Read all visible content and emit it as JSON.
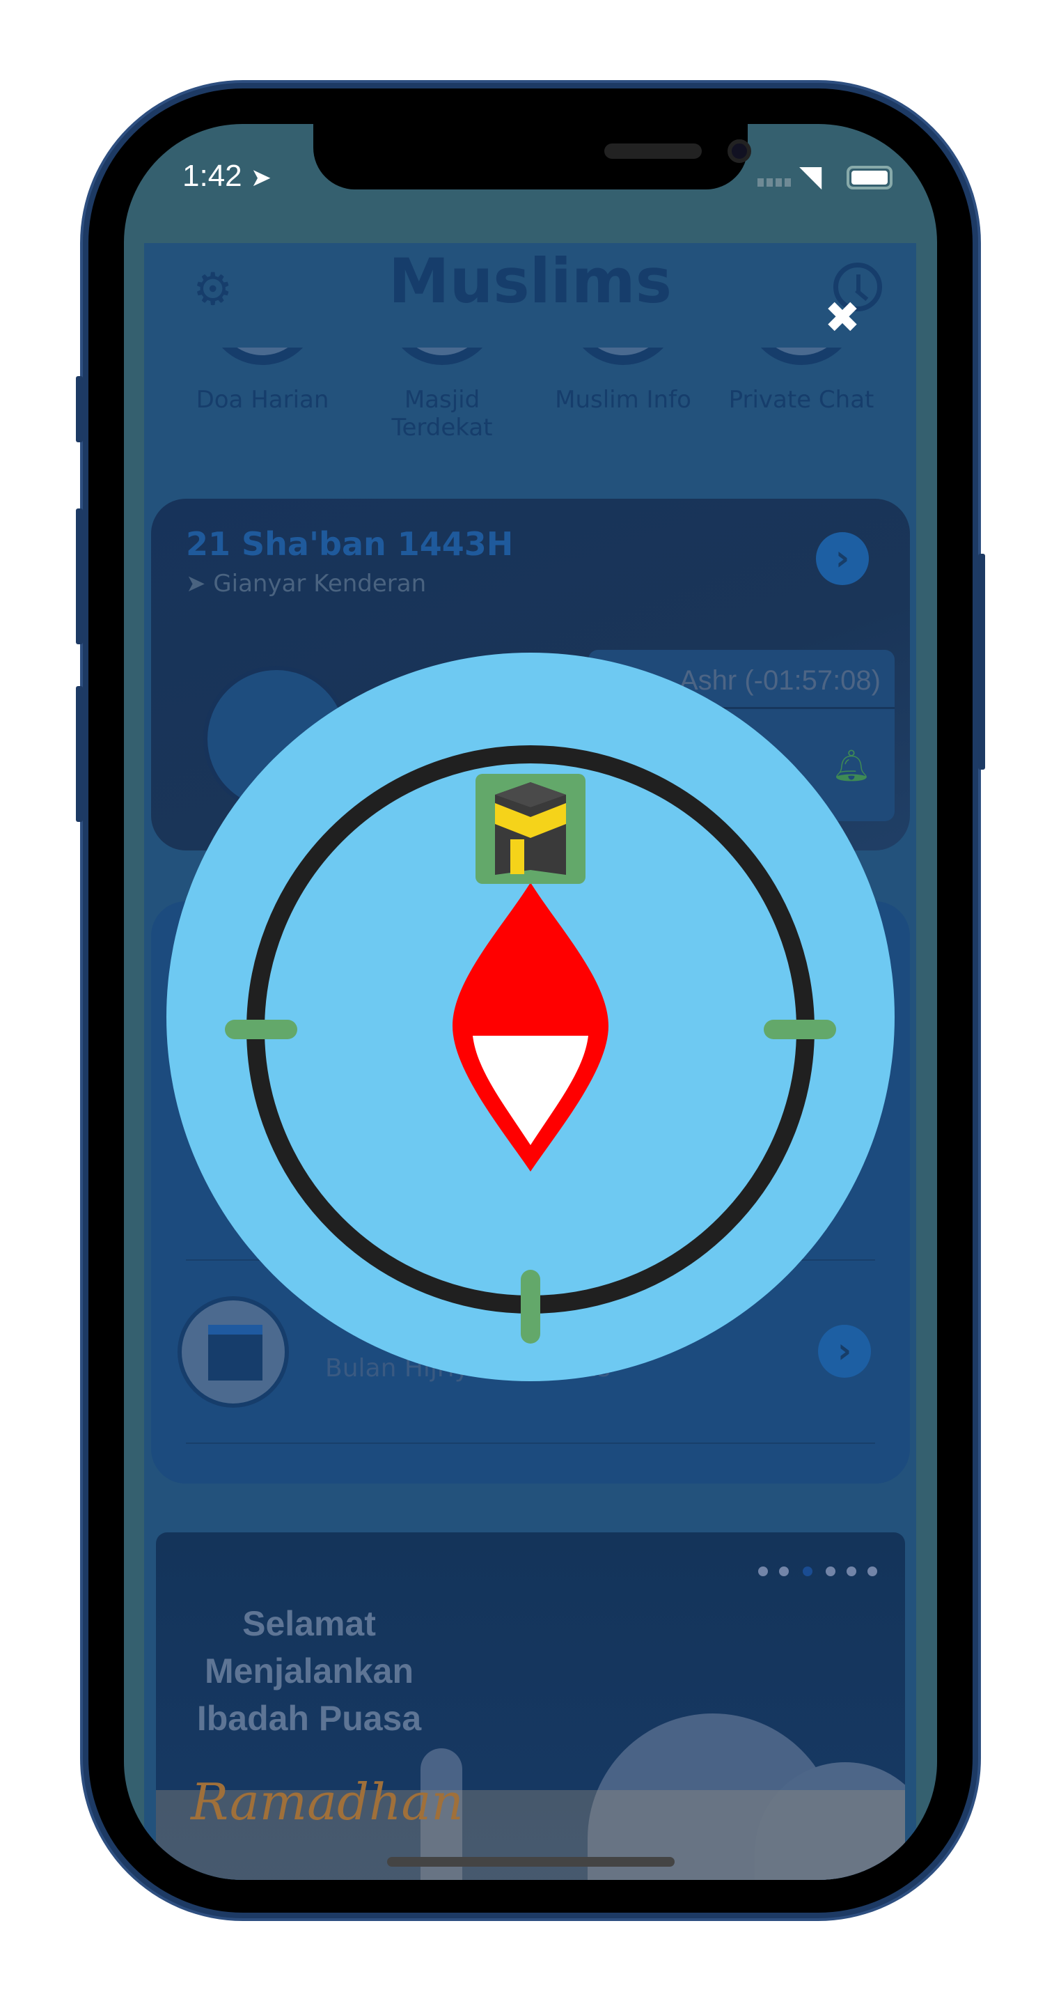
{
  "status_bar": {
    "time": "1:42",
    "icons": [
      "location-arrow-icon",
      "signal-icon",
      "wifi-icon",
      "battery-icon"
    ]
  },
  "header": {
    "title": "Muslims",
    "left_icon": "gear-icon",
    "right_icon": "history-icon"
  },
  "nav": [
    {
      "label": "Doa Harian"
    },
    {
      "label": "Masjid Terdekat"
    },
    {
      "label": "Muslim Info"
    },
    {
      "label": "Private Chat"
    }
  ],
  "prayer_card": {
    "date": "21 Sha'ban 1443H",
    "location": "Gianyar Kenderan",
    "next_prayer": "Ashr",
    "countdown": "(-01:57:08)"
  },
  "menu": {
    "calendar_subtitle": "Bulan Hijriyah Muslims"
  },
  "banner": {
    "lines": [
      "Selamat",
      "Menjalankan",
      "Ibadah Puasa"
    ],
    "script": "Ramadhan",
    "active_dot": 3,
    "dot_count": 6
  },
  "overlay": {
    "type": "qibla-compass",
    "close_icon": "close-icon",
    "colors": {
      "disc": "#6ec9f2",
      "ring": "#202020",
      "ticks": "#63a86a",
      "needle": "#ff0000"
    }
  }
}
